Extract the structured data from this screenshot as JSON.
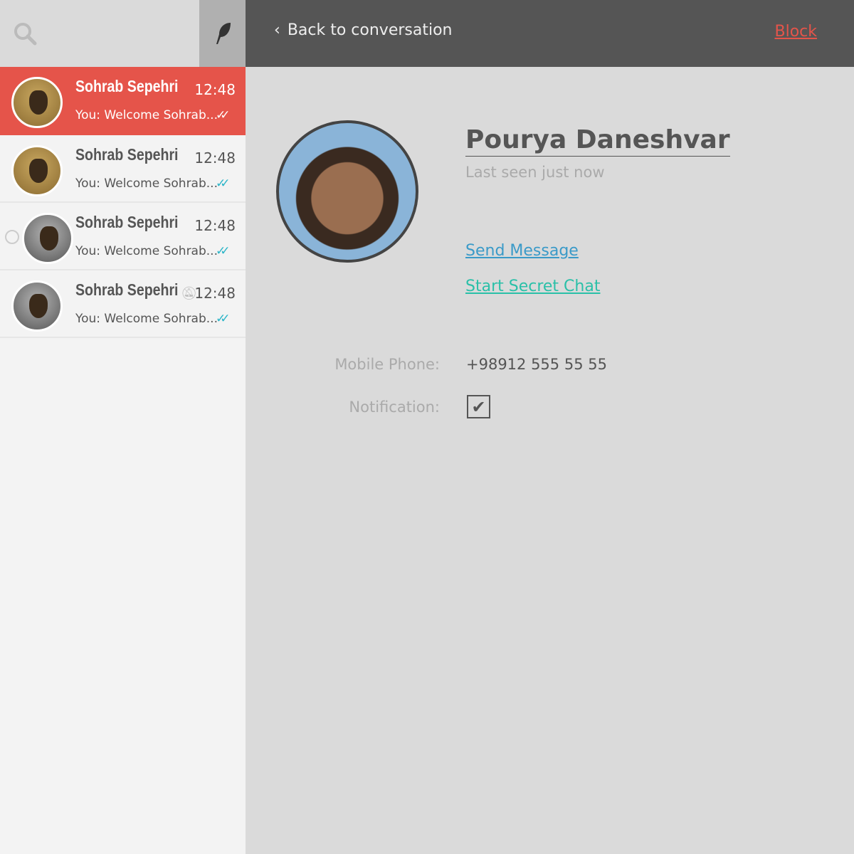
{
  "sidebar": {
    "chats": [
      {
        "name": "Sohrab Sepehri",
        "time": "12:48",
        "message": "You: Welcome Sohrab...",
        "ticks": "✓✓"
      },
      {
        "name": "Sohrab Sepehri",
        "time": "12:48",
        "message": "You: Welcome Sohrab...",
        "ticks": "✓✓"
      },
      {
        "name": "Sohrab Sepehri",
        "time": "12:48",
        "message": "You: Welcome Sohrab...",
        "ticks": "✓✓"
      },
      {
        "name": "Sohrab Sepehri",
        "time": "12:48",
        "message": "You: Welcome Sohrab...",
        "ticks": "✓✓",
        "muted": true
      }
    ]
  },
  "header": {
    "back_label": "Back to conversation",
    "block_label": "Block"
  },
  "profile": {
    "name": "Pourya Daneshvar",
    "status": "Last seen just now",
    "send_message": "Send Message",
    "secret_chat": "Start Secret Chat",
    "phone_label": "Mobile Phone:",
    "phone": "+98912 555 55 55",
    "notification_label": "Notification:",
    "notification_checked": true
  },
  "colors": {
    "accent": "#e5544a",
    "link": "#3a9ac8",
    "secret": "#2ac0a8"
  }
}
